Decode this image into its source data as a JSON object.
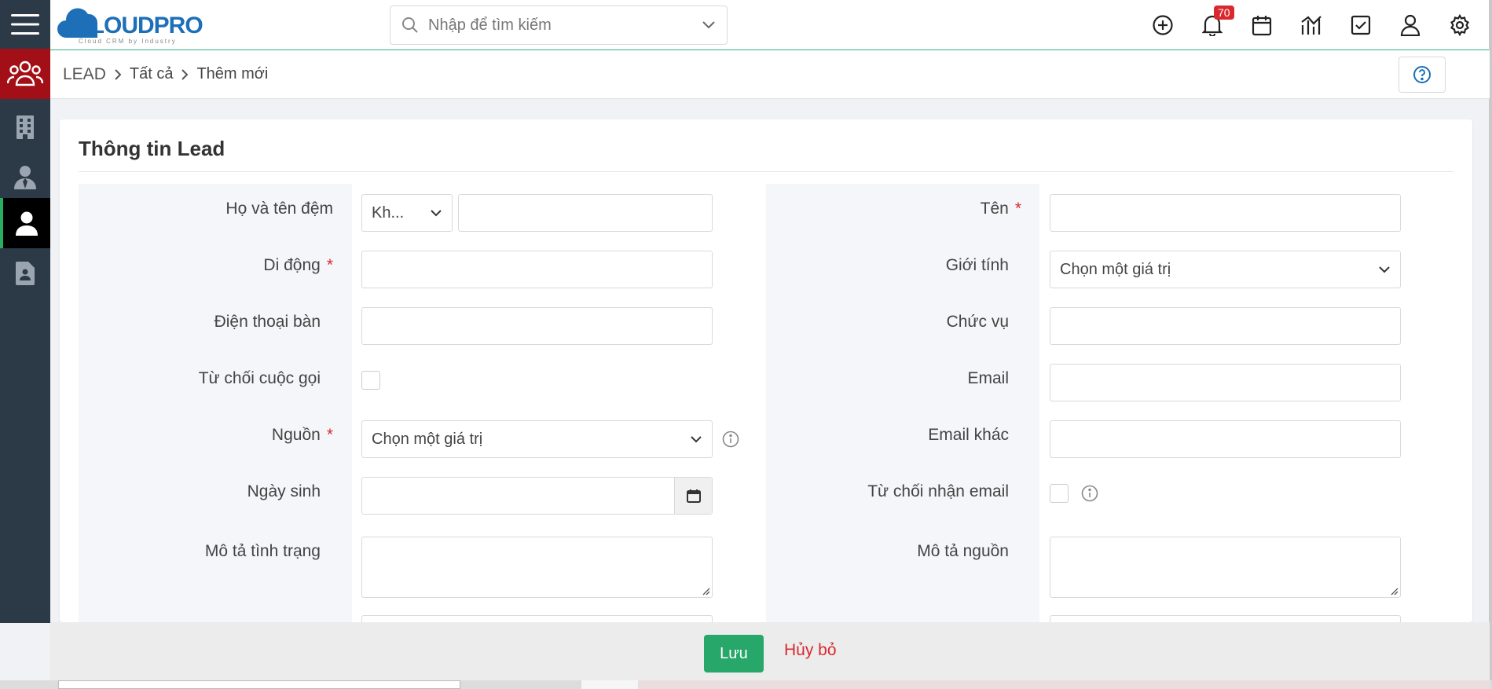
{
  "app": {
    "logo_text": "CLOUDPRO",
    "logo_tagline": "Cloud CRM by Industry"
  },
  "search": {
    "placeholder": "Nhập để tìm kiếm"
  },
  "notifications": {
    "count": "70"
  },
  "breadcrumb": {
    "items": [
      "LEAD",
      "Tất cả",
      "Thêm mới"
    ]
  },
  "form": {
    "title": "Thông tin Lead",
    "left": {
      "middle_name_label": "Họ và tên đệm",
      "salutation_value": "Kh...",
      "mobile_label": "Di động",
      "phone_label": "Điện thoại bàn",
      "reject_call_label": "Từ chối cuộc gọi",
      "source_label": "Nguồn",
      "source_value": "Chọn một giá trị",
      "birthday_label": "Ngày sinh",
      "status_desc_label": "Mô tả tình trạng"
    },
    "right": {
      "name_label": "Tên",
      "gender_label": "Giới tính",
      "gender_value": "Chọn một giá trị",
      "position_label": "Chức vụ",
      "email_label": "Email",
      "email_other_label": "Email khác",
      "reject_email_label": "Từ chối nhận email",
      "source_desc_label": "Mô tả nguồn"
    },
    "required_mark": "*"
  },
  "footer": {
    "save_label": "Lưu",
    "cancel_label": "Hủy bỏ"
  },
  "colors": {
    "sidebar": "#2c3a47",
    "active_red": "#a30f17",
    "save_green": "#27a86a",
    "danger": "#d9292f",
    "brand_blue": "#1d6fb8"
  },
  "icons": [
    "menu-icon",
    "leads-group-icon",
    "building-icon",
    "contact-icon",
    "person-icon",
    "document-icon",
    "search-icon",
    "chevron-down-icon",
    "plus-circle-icon",
    "bell-icon",
    "calendar-icon",
    "chart-icon",
    "task-icon",
    "user-icon",
    "gear-icon",
    "help-icon",
    "info-icon"
  ]
}
